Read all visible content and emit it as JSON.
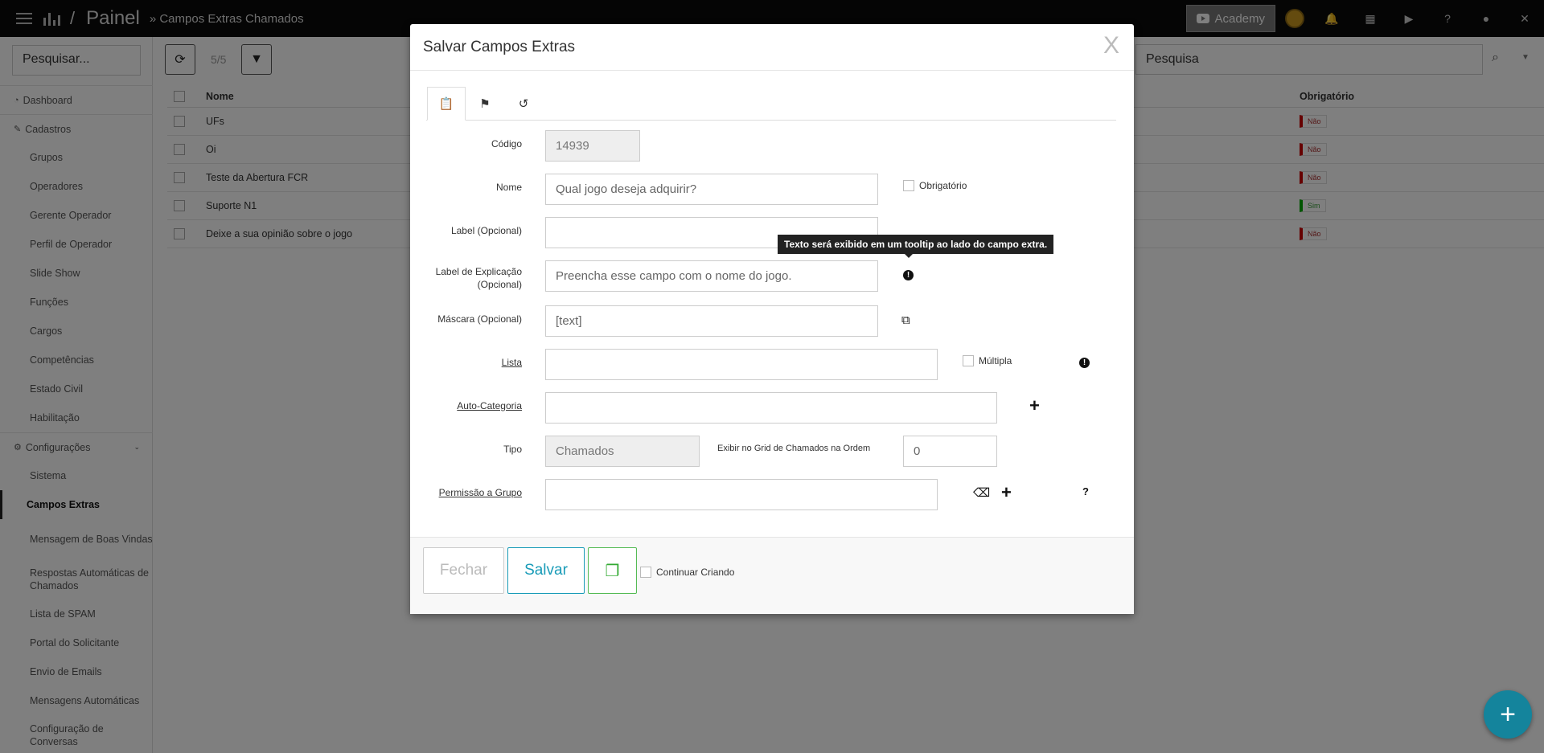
{
  "topbar": {
    "app_name": "Painel",
    "separator": "/",
    "breadcrumb": "» Campos Extras Chamados",
    "academy_label": "Academy"
  },
  "sidebar": {
    "search_placeholder": "Pesquisar...",
    "items": [
      {
        "label": "Dashboard",
        "type": "section",
        "icon": "dashboard-icon"
      },
      {
        "label": "Cadastros",
        "type": "section",
        "icon": "edit-icon"
      },
      {
        "label": "Grupos"
      },
      {
        "label": "Operadores"
      },
      {
        "label": "Gerente Operador"
      },
      {
        "label": "Perfil de Operador"
      },
      {
        "label": "Slide Show"
      },
      {
        "label": "Funções"
      },
      {
        "label": "Cargos"
      },
      {
        "label": "Competências"
      },
      {
        "label": "Estado Civil"
      },
      {
        "label": "Habilitação"
      },
      {
        "label": "Configurações",
        "type": "section",
        "icon": "gear-icon"
      },
      {
        "label": "Sistema"
      },
      {
        "label": "Campos Extras",
        "active": true
      },
      {
        "label": "Mensagem de Boas Vindas",
        "two": true
      },
      {
        "label": "Respostas Automáticas de Chamados",
        "two": true
      },
      {
        "label": "Lista de SPAM"
      },
      {
        "label": "Portal do Solicitante"
      },
      {
        "label": "Envio de Emails"
      },
      {
        "label": "Mensagens Automáticas"
      },
      {
        "label": "Configuração de Conversas",
        "two": true
      }
    ]
  },
  "toolbar": {
    "counter": "5/5",
    "search_placeholder": "Pesquisa"
  },
  "grid": {
    "columns": {
      "name": "Nome",
      "required": "Obrigatório"
    },
    "rows": [
      {
        "name": "UFs",
        "required": "Não",
        "yes": false
      },
      {
        "name": "Oi",
        "required": "Não",
        "yes": false
      },
      {
        "name": "Teste da Abertura FCR",
        "required": "Não",
        "yes": false
      },
      {
        "name": "Suporte N1",
        "required": "Sim",
        "yes": true
      },
      {
        "name": "Deixe a sua opinião sobre o jogo",
        "required": "Não",
        "yes": false
      }
    ]
  },
  "modal": {
    "title": "Salvar Campos Extras",
    "close": "X",
    "fields": {
      "codigo_label": "Código",
      "codigo_value": "14939",
      "nome_label": "Nome",
      "nome_value": "Qual jogo deseja adquirir?",
      "obrigatorio_label": "Obrigatório",
      "label_opcional_label": "Label (Opcional)",
      "label_opcional_value": "",
      "explicacao_label": "Label de Explicação (Opcional)",
      "explicacao_value": "Preencha esse campo com o nome do jogo.",
      "tooltip": "Texto será exibido em um tooltip ao lado do campo extra.",
      "mascara_label": "Máscara (Opcional)",
      "mascara_value": "[text]",
      "lista_label": "Lista",
      "multipla_label": "Múltipla",
      "auto_categoria_label": "Auto-Categoria",
      "tipo_label": "Tipo",
      "tipo_value": "Chamados",
      "exibir_label": "Exibir no Grid de Chamados na Ordem",
      "exibir_value": "0",
      "permissao_label": "Permissão a Grupo",
      "help_mark": "?"
    },
    "footer": {
      "close_label": "Fechar",
      "save_label": "Salvar",
      "continue_label": "Continuar Criando"
    }
  },
  "fab_label": "+"
}
